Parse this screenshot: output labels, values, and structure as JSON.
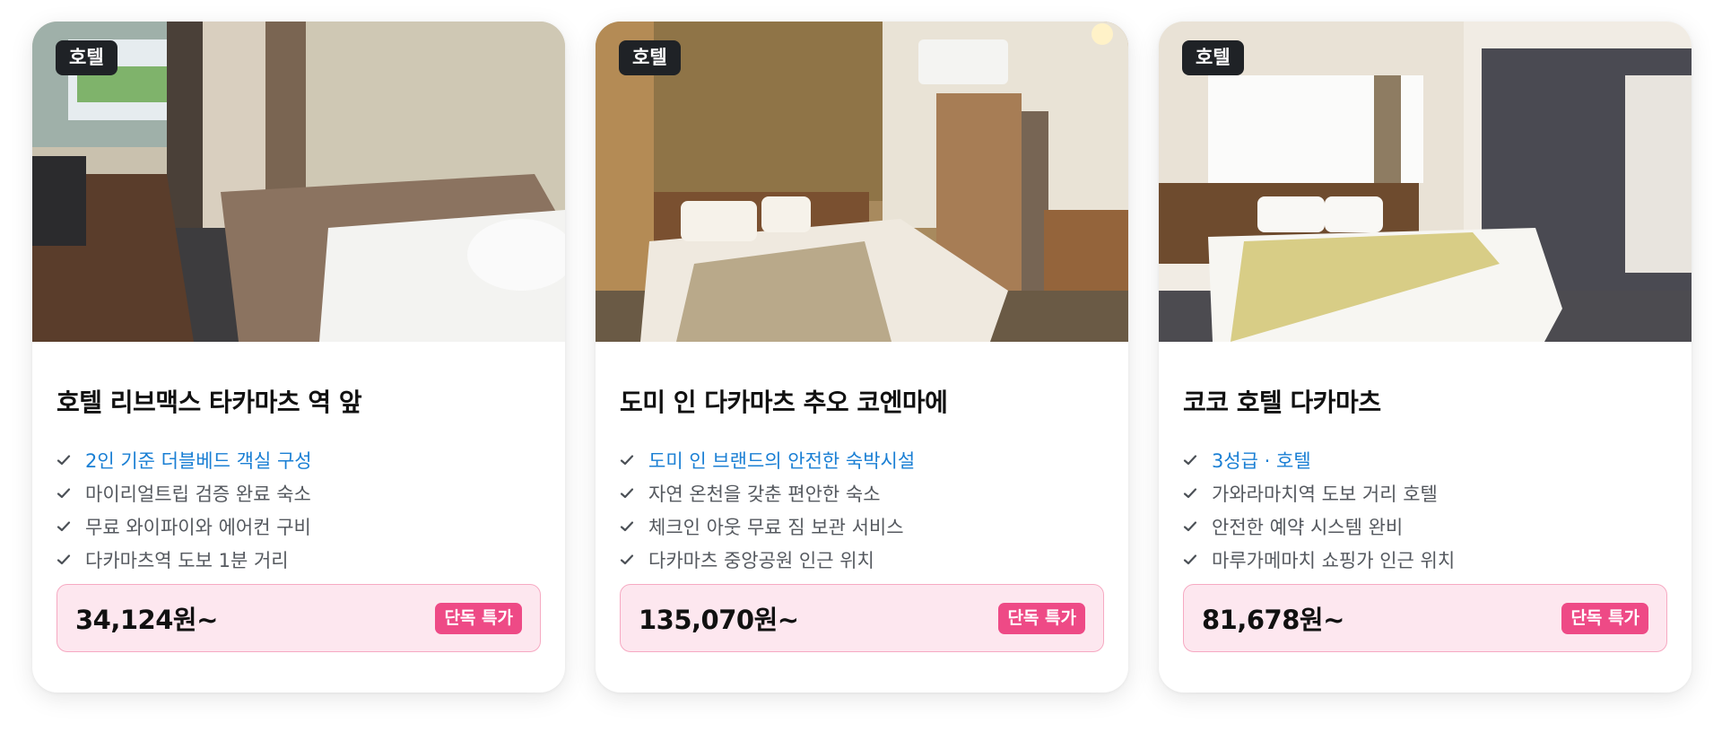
{
  "cards": [
    {
      "category": "호텔",
      "name": "호텔 리브맥스 타카마츠 역 앞",
      "features": [
        "2인 기준 더블베드 객실 구성",
        "마이리얼트립 검증 완료 숙소",
        "무료 와이파이와 에어컨 구비",
        "다카마츠역 도보 1분 거리"
      ],
      "price": "34,124원~",
      "deal_label": "단독 특가"
    },
    {
      "category": "호텔",
      "name": "도미 인 다카마츠 추오 코엔마에",
      "features": [
        "도미 인 브랜드의 안전한 숙박시설",
        "자연 온천을 갖춘 편안한 숙소",
        "체크인 아웃 무료 짐 보관 서비스",
        "다카마츠 중앙공원 인근 위치"
      ],
      "price": "135,070원~",
      "deal_label": "단독 특가"
    },
    {
      "category": "호텔",
      "name": "코코 호텔 다카마츠",
      "features": [
        "3성급 · 호텔",
        "가와라마치역 도보 거리 호텔",
        "안전한 예약 시스템 완비",
        "마루가메마치 쇼핑가 인근 위치"
      ],
      "price": "81,678원~",
      "deal_label": "단독 특가"
    }
  ],
  "colors": {
    "highlight_text": "#1a7fd4",
    "deal_badge": "#ee4a86",
    "price_box_bg": "#fde7ef",
    "category_badge": "#1f2226"
  },
  "icons": {
    "feature": "check-icon"
  }
}
